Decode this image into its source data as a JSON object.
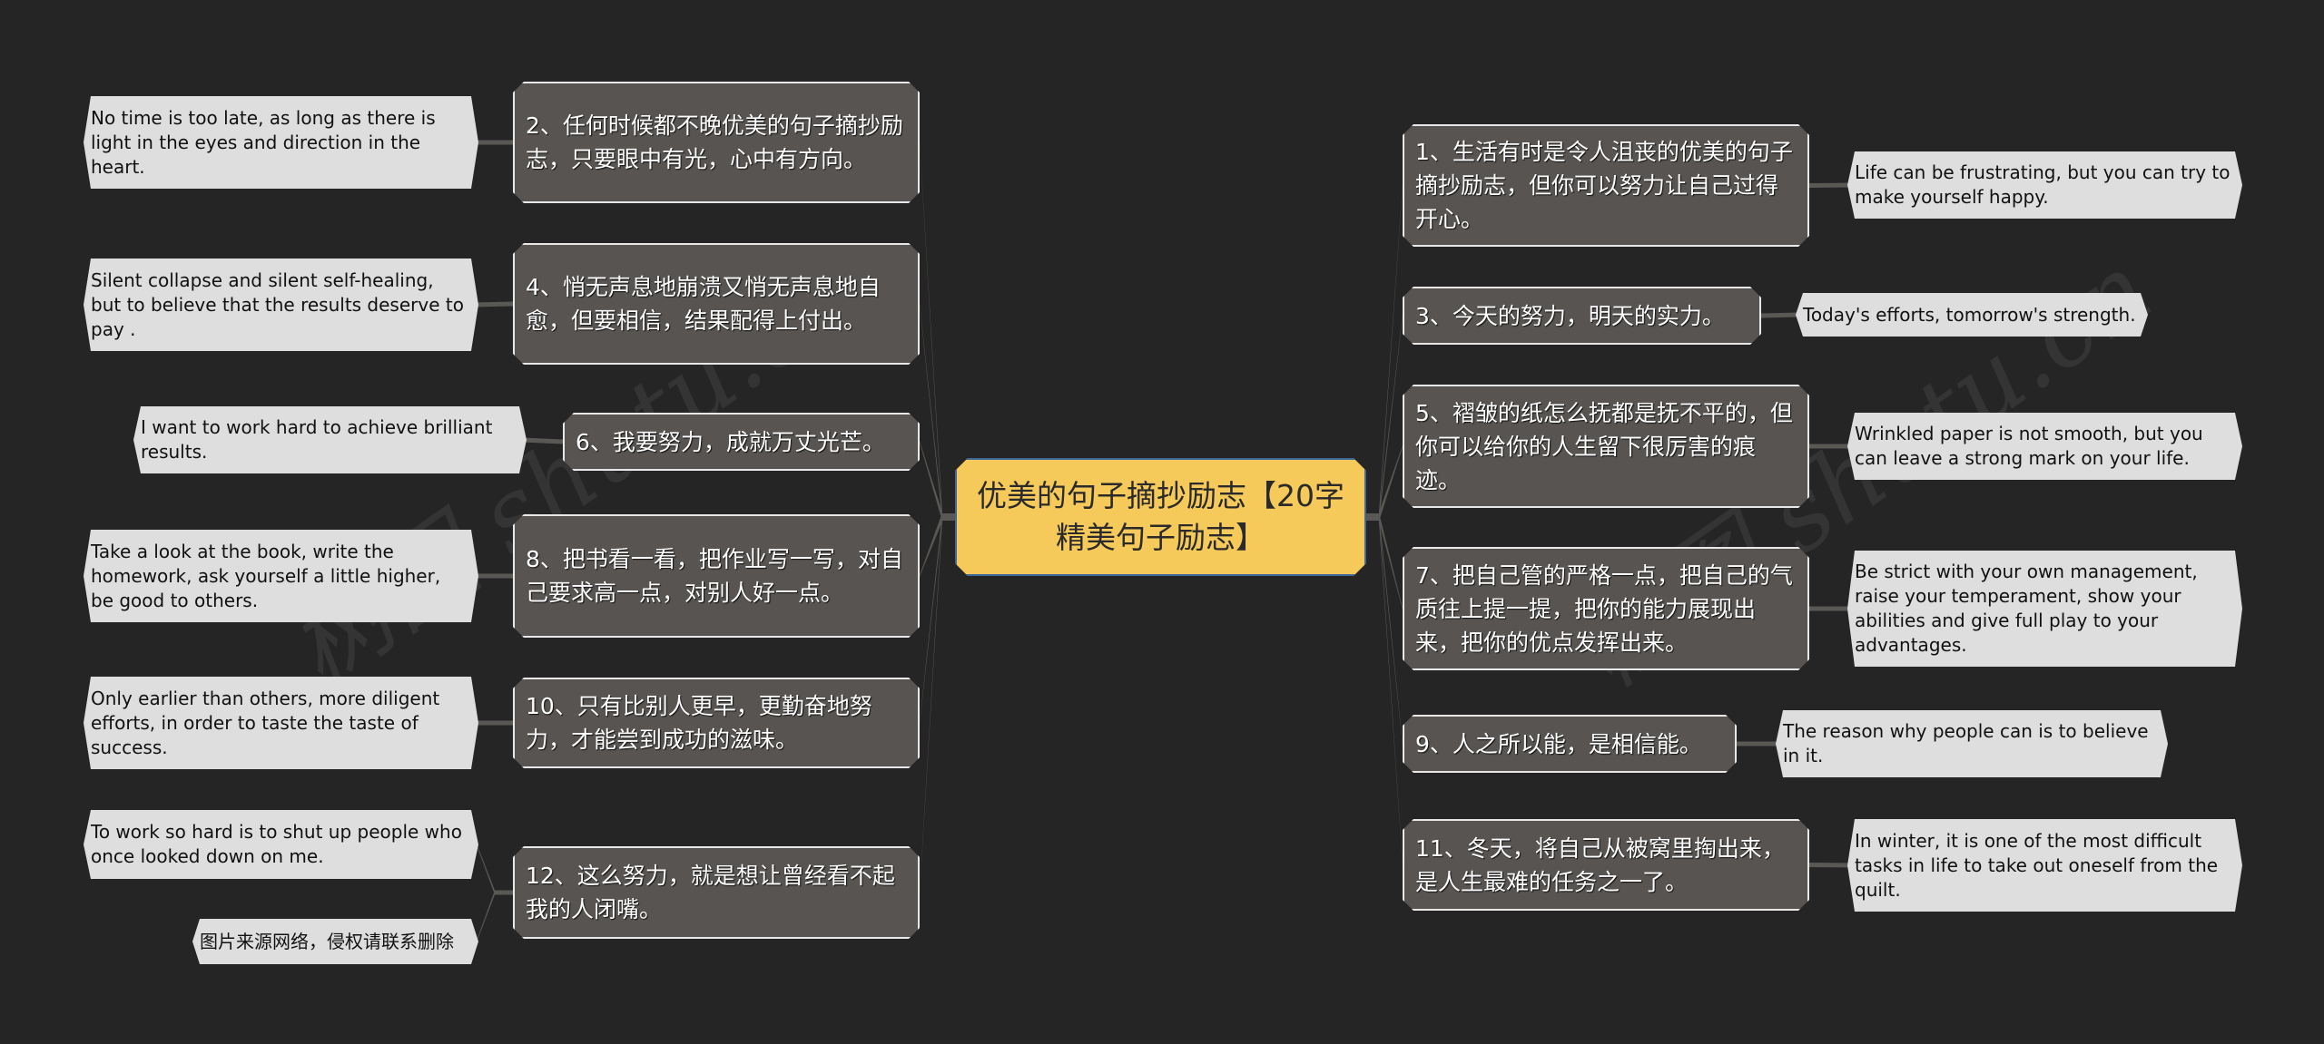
{
  "center": {
    "title": "优美的句子摘抄励志【20字精美句子励志】"
  },
  "left_branches": [
    {
      "text": "2、任何时候都不晚优美的句子摘抄励志，只要眼中有光，心中有方向。",
      "leaves": [
        "No time is too late, as long as there is light in the eyes and direction in the heart."
      ]
    },
    {
      "text": "4、悄无声息地崩溃又悄无声息地自愈，但要相信，结果配得上付出。",
      "leaves": [
        "Silent collapse and silent self-healing, but to believe that the results deserve to pay ."
      ]
    },
    {
      "text": "6、我要努力，成就万丈光芒。",
      "leaves": [
        "I want to work hard to achieve brilliant results."
      ]
    },
    {
      "text": "8、把书看一看，把作业写一写，对自己要求高一点，对别人好一点。",
      "leaves": [
        "Take a look at the book, write the homework, ask yourself a little higher, be good to others."
      ]
    },
    {
      "text": "10、只有比别人更早，更勤奋地努力，才能尝到成功的滋味。",
      "leaves": [
        "Only earlier than others, more diligent efforts, in order to taste the taste of success."
      ]
    },
    {
      "text": "12、这么努力，就是想让曾经看不起我的人闭嘴。",
      "leaves": [
        "To work so hard is to shut up people who once looked down on me.",
        "图片来源网络，侵权请联系删除"
      ]
    }
  ],
  "right_branches": [
    {
      "text": "1、生活有时是令人沮丧的优美的句子摘抄励志，但你可以努力让自己过得开心。",
      "leaves": [
        "Life can be frustrating, but you can try to make yourself happy."
      ]
    },
    {
      "text": "3、今天的努力，明天的实力。",
      "leaves": [
        "Today's efforts, tomorrow's strength."
      ]
    },
    {
      "text": "5、褶皱的纸怎么抚都是抚不平的，但你可以给你的人生留下很厉害的痕迹。",
      "leaves": [
        "Wrinkled paper is not smooth, but you can leave a strong mark on your life."
      ]
    },
    {
      "text": "7、把自己管的严格一点，把自己的气质往上提一提，把你的能力展现出来，把你的优点发挥出来。",
      "leaves": [
        "Be strict with your own management, raise your temperament, show your abilities and give full play to your advantages."
      ]
    },
    {
      "text": "9、人之所以能，是相信能。",
      "leaves": [
        "The reason why people can is to believe in it."
      ]
    },
    {
      "text": "11、冬天，将自己从被窝里掏出来，是人生最难的任务之一了。",
      "leaves": [
        "In winter, it is one of the most difficult tasks in life to take out oneself from the quilt."
      ]
    }
  ],
  "watermark": {
    "left": "树图 shutu.cn",
    "right": "树图 shutu.cn"
  },
  "colors": {
    "background": "#252525",
    "center_fill": "#f5c95a",
    "center_border": "#3d6a9a",
    "branch_fill": "#575451",
    "leaf_fill": "#dedede",
    "connector": "#5a5855"
  }
}
